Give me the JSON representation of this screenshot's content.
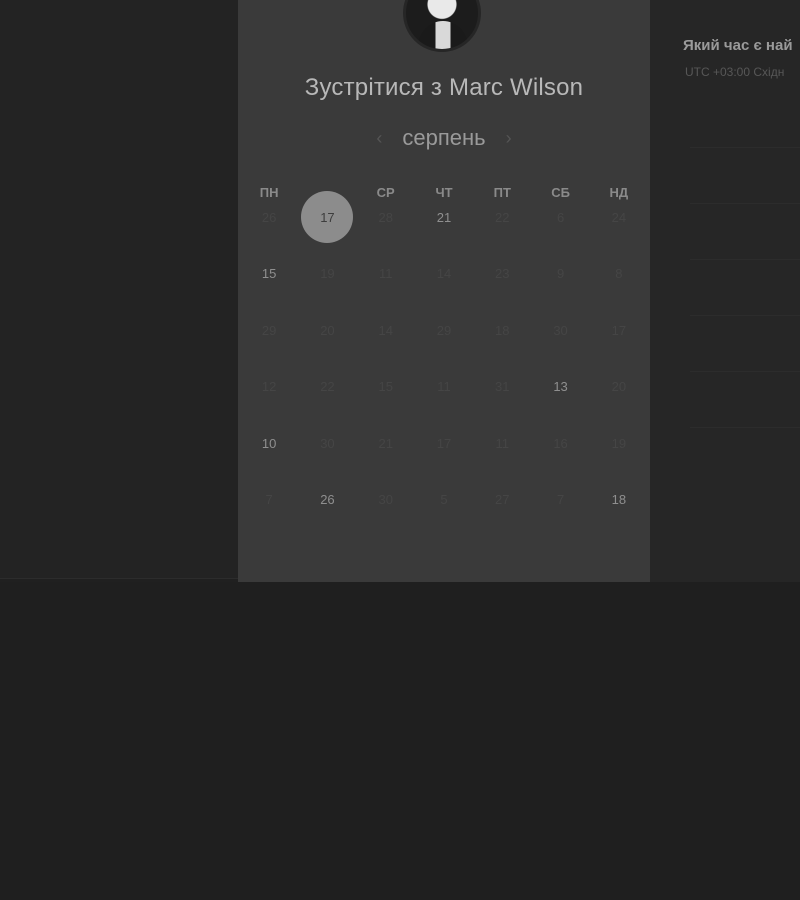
{
  "card": {
    "title": "Зустрітися з Marc Wilson",
    "month": "серпень",
    "prev_icon": "‹",
    "next_icon": "›"
  },
  "weekdays": [
    "ПН",
    "ВТ",
    "СР",
    "ЧТ",
    "ПТ",
    "СБ",
    "НД"
  ],
  "calendar": {
    "weeks": [
      [
        {
          "d": "26",
          "a": false
        },
        {
          "d": "17",
          "a": true,
          "selected": true
        },
        {
          "d": "28",
          "a": false
        },
        {
          "d": "21",
          "a": true
        },
        {
          "d": "22",
          "a": false
        },
        {
          "d": "6",
          "a": false
        },
        {
          "d": "24",
          "a": false
        }
      ],
      [
        {
          "d": "15",
          "a": true
        },
        {
          "d": "19",
          "a": false
        },
        {
          "d": "11",
          "a": false
        },
        {
          "d": "14",
          "a": false
        },
        {
          "d": "23",
          "a": false
        },
        {
          "d": "9",
          "a": false
        },
        {
          "d": "8",
          "a": false
        }
      ],
      [
        {
          "d": "29",
          "a": false
        },
        {
          "d": "20",
          "a": false
        },
        {
          "d": "14",
          "a": false
        },
        {
          "d": "29",
          "a": false
        },
        {
          "d": "18",
          "a": false
        },
        {
          "d": "30",
          "a": false
        },
        {
          "d": "17",
          "a": false
        }
      ],
      [
        {
          "d": "12",
          "a": false
        },
        {
          "d": "22",
          "a": false
        },
        {
          "d": "15",
          "a": false
        },
        {
          "d": "11",
          "a": false
        },
        {
          "d": "31",
          "a": false
        },
        {
          "d": "13",
          "a": true
        },
        {
          "d": "20",
          "a": false
        }
      ],
      [
        {
          "d": "10",
          "a": true
        },
        {
          "d": "30",
          "a": false
        },
        {
          "d": "21",
          "a": false
        },
        {
          "d": "17",
          "a": false
        },
        {
          "d": "11",
          "a": false
        },
        {
          "d": "16",
          "a": false
        },
        {
          "d": "19",
          "a": false
        }
      ],
      [
        {
          "d": "7",
          "a": false
        },
        {
          "d": "26",
          "a": true
        },
        {
          "d": "30",
          "a": false
        },
        {
          "d": "5",
          "a": false
        },
        {
          "d": "27",
          "a": false
        },
        {
          "d": "7",
          "a": false
        },
        {
          "d": "18",
          "a": true
        }
      ]
    ]
  },
  "right": {
    "title": "Який час є най",
    "subtitle": "UTC +03:00 Східн"
  },
  "colors": {
    "background": "#202020",
    "card": "#3a3a3a",
    "selected": "#8c8c8c"
  }
}
